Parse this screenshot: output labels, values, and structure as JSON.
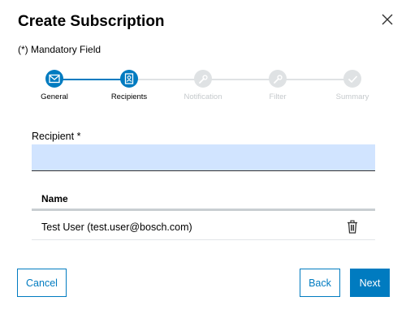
{
  "dialog": {
    "title": "Create Subscription",
    "mandatory_note": "(*) Mandatory Field"
  },
  "stepper": {
    "steps": [
      {
        "label": "General",
        "icon": "envelope-icon",
        "state": "completed"
      },
      {
        "label": "Recipients",
        "icon": "contact-book-icon",
        "state": "current"
      },
      {
        "label": "Notification",
        "icon": "wrench-icon",
        "state": "upcoming"
      },
      {
        "label": "Filter",
        "icon": "wrench-icon",
        "state": "upcoming"
      },
      {
        "label": "Summary",
        "icon": "checkmark-icon",
        "state": "upcoming"
      }
    ],
    "colors": {
      "active": "#007bc0",
      "inactive": "#dfe2e4"
    }
  },
  "recipient": {
    "label": "Recipient *",
    "value": "",
    "input_bg": "#d1e4ff"
  },
  "table": {
    "columns": [
      "Name"
    ],
    "rows": [
      {
        "name": "Test User (test.user@bosch.com)"
      }
    ]
  },
  "footer": {
    "cancel_label": "Cancel",
    "back_label": "Back",
    "next_label": "Next"
  },
  "colors": {
    "accent": "#007bc0"
  }
}
